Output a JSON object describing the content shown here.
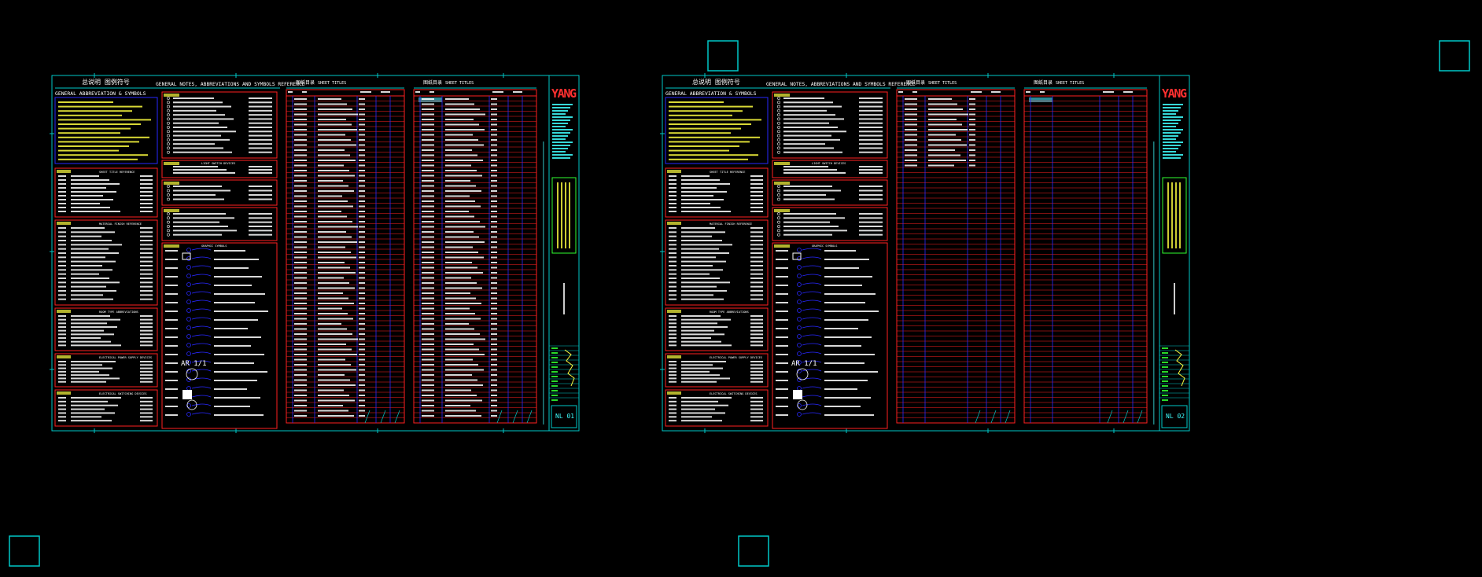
{
  "sheets": [
    {
      "id": "left",
      "title_cn": "总说明 图例符号",
      "title_en": "GENERAL NOTES, ABBREVIATIONS AND SYMBOLS REFERENCE",
      "section_abbrev": "GENERAL ABBREVIATION & SYMBOLS",
      "index_header_1_cn": "图纸目录",
      "index_header_1_en": "SHEET TITLES",
      "index_header_2_cn": "图纸目录",
      "index_header_2_en": "SHEET TITLES",
      "brand": "YANG",
      "sheet_no": "NL 01",
      "table_rows_filled": true
    },
    {
      "id": "right",
      "title_cn": "总说明 图例符号",
      "title_en": "GENERAL NOTES, ABBREVIATIONS AND SYMBOLS REFERENCE",
      "section_abbrev": "GENERAL ABBREVIATION & SYMBOLS",
      "index_header_1_cn": "图纸目录",
      "index_header_1_en": "SHEET TITLES",
      "index_header_2_cn": "图纸目录",
      "index_header_2_en": "SHEET TITLES",
      "brand": "YANG",
      "sheet_no": "NL 02",
      "table_rows_filled": false
    }
  ],
  "side_labels": {
    "sub_abbrev": "SHEET TITLE REFERENCE",
    "sub_finish": "MATERIAL FINISH REFERENCE",
    "sub_room": "ROOM TYPE ABBREVIATIONS",
    "sub_elec": "ELECTRICAL POWER SUPPLY DEVICES",
    "sub_switch": "ELECTRICAL SWITCHING DEVICES",
    "sub_light": "LIGHT SWITCH DEVICES",
    "sub_graphic": "GRAPHIC SYMBOLS",
    "ar_label": "AR 1/1"
  },
  "colors": {
    "background": "#000000",
    "frame": "#00c8c8",
    "table_red": "#ff2020",
    "table_blue": "#2828ff",
    "text_white": "#ffffff",
    "text_yellow": "#ffff40",
    "text_cyan": "#40ffff",
    "brand_red": "#ff3030",
    "green": "#30ff30"
  }
}
